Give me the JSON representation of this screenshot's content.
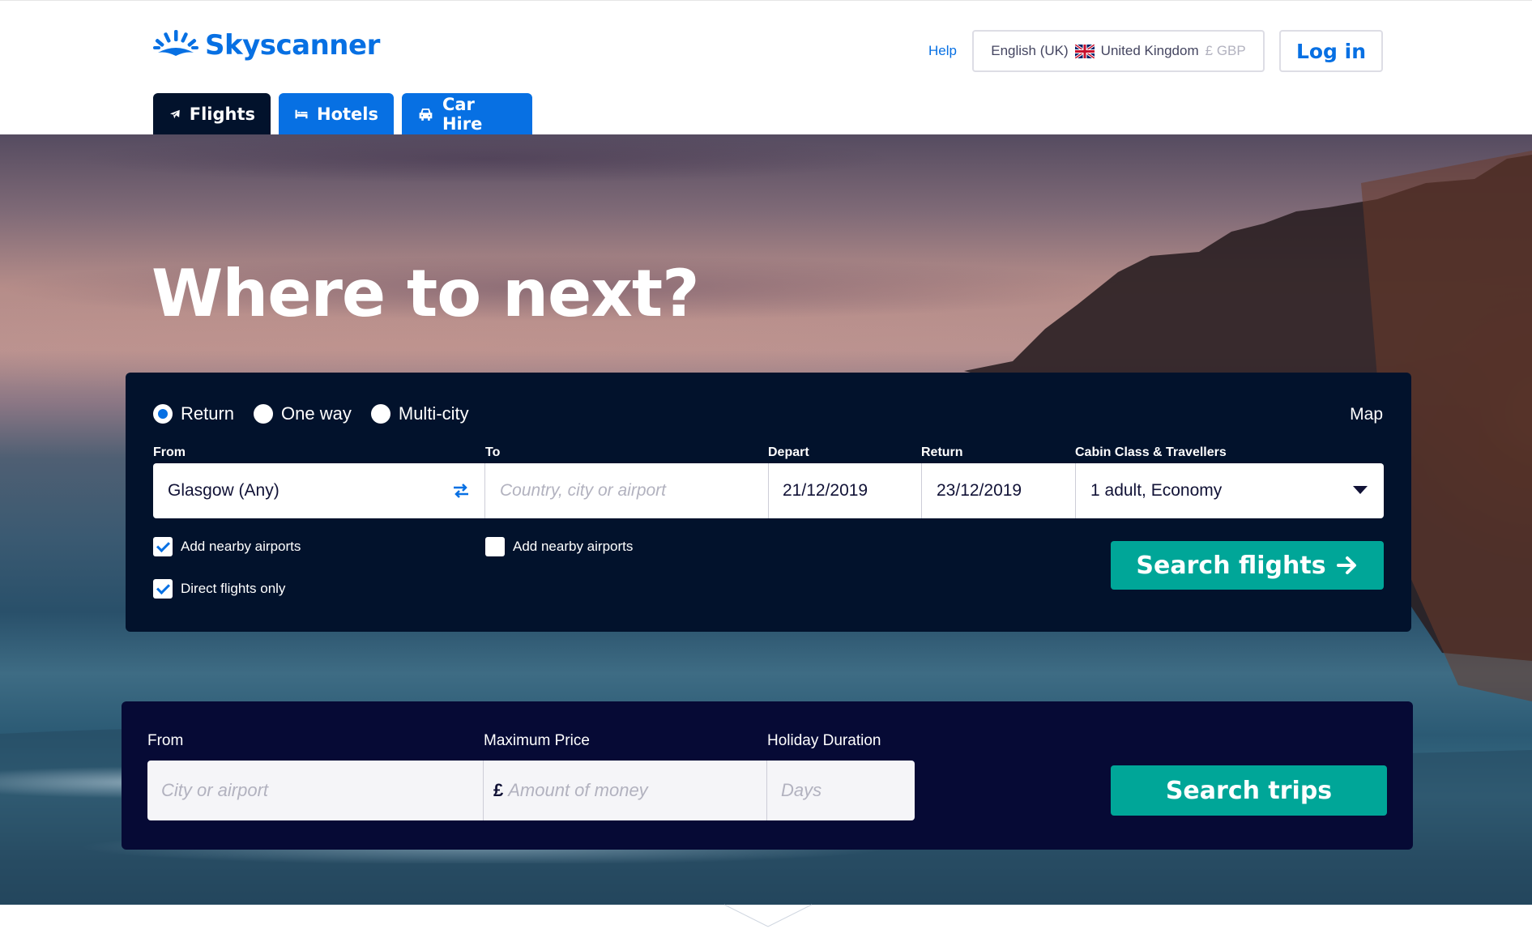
{
  "brand": {
    "name": "Skyscanner",
    "color": "#0770e3",
    "logo_icon": "sunrise-logo-icon"
  },
  "header": {
    "help_label": "Help",
    "locale": {
      "language": "English (UK)",
      "country": "United Kingdom",
      "currency": "£ GBP",
      "flag_icon": "uk-flag-icon"
    },
    "login_label": "Log in"
  },
  "tabs": [
    {
      "label": "Flights",
      "icon": "plane-icon",
      "active": true
    },
    {
      "label": "Hotels",
      "icon": "bed-icon",
      "active": false
    },
    {
      "label": "Car Hire",
      "icon": "car-icon",
      "active": false
    }
  ],
  "hero": {
    "title": "Where to next?"
  },
  "flight_search": {
    "trip_types": [
      {
        "label": "Return",
        "selected": true
      },
      {
        "label": "One way",
        "selected": false
      },
      {
        "label": "Multi-city",
        "selected": false
      }
    ],
    "map_label": "Map",
    "from": {
      "label": "From",
      "value": "Glasgow (Any)"
    },
    "to": {
      "label": "To",
      "placeholder": "Country, city or airport"
    },
    "depart": {
      "label": "Depart",
      "value": "21/12/2019"
    },
    "return": {
      "label": "Return",
      "value": "23/12/2019"
    },
    "cabin": {
      "label": "Cabin Class & Travellers",
      "value": "1 adult, Economy"
    },
    "from_nearby": {
      "label": "Add nearby airports",
      "checked": true
    },
    "to_nearby": {
      "label": "Add nearby airports",
      "checked": false
    },
    "direct_only": {
      "label": "Direct flights only",
      "checked": true
    },
    "search_label": "Search flights",
    "search_color": "#00a698"
  },
  "trip_search": {
    "from": {
      "label": "From",
      "placeholder": "City or airport"
    },
    "max_price": {
      "label": "Maximum Price",
      "currency": "£",
      "placeholder": "Amount of money"
    },
    "duration": {
      "label": "Holiday Duration",
      "placeholder": "Days"
    },
    "search_label": "Search trips"
  }
}
